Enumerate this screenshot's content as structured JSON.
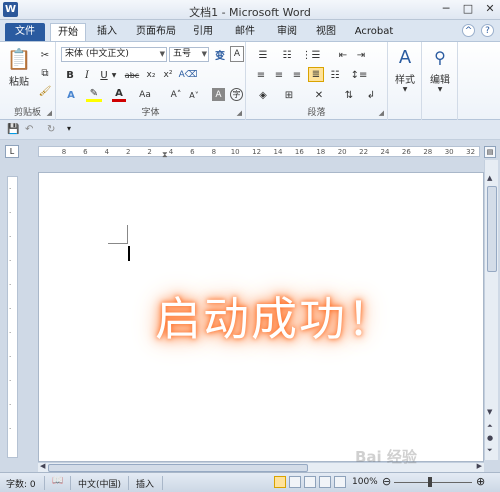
{
  "window": {
    "title": "文档1 - Microsoft Word",
    "logo_letter": "W"
  },
  "qat_icons": [
    "save-icon",
    "undo-icon",
    "redo-icon",
    "customize-icon"
  ],
  "tabs": [
    {
      "label": "文件"
    },
    {
      "label": "开始"
    },
    {
      "label": "插入"
    },
    {
      "label": "页面布局"
    },
    {
      "label": "引用"
    },
    {
      "label": "邮件"
    },
    {
      "label": "审阅"
    },
    {
      "label": "视图"
    },
    {
      "label": "Acrobat"
    }
  ],
  "ribbon": {
    "clipboard": {
      "label": "剪贴板",
      "paste": "粘贴"
    },
    "font": {
      "label": "字体",
      "font_name": "宋体 (中文正文)",
      "font_size": "五号"
    },
    "paragraph": {
      "label": "段落"
    },
    "styles": {
      "label": "样式"
    },
    "editing": {
      "label": "编辑"
    }
  },
  "ruler_ticks": [
    "8",
    "6",
    "4",
    "2",
    "2",
    "4",
    "6",
    "8",
    "10",
    "12",
    "14",
    "16",
    "18",
    "20",
    "22",
    "24",
    "26",
    "28",
    "30",
    "32"
  ],
  "document": {
    "overlay_text": "启动成功！"
  },
  "status": {
    "word_count": "字数: 0",
    "language": "中文(中国)",
    "mode": "插入",
    "zoom": "100%"
  },
  "watermark": "Bai 经验",
  "colors": {
    "accent": "#2b579a",
    "glow": "#ff6a1e"
  }
}
